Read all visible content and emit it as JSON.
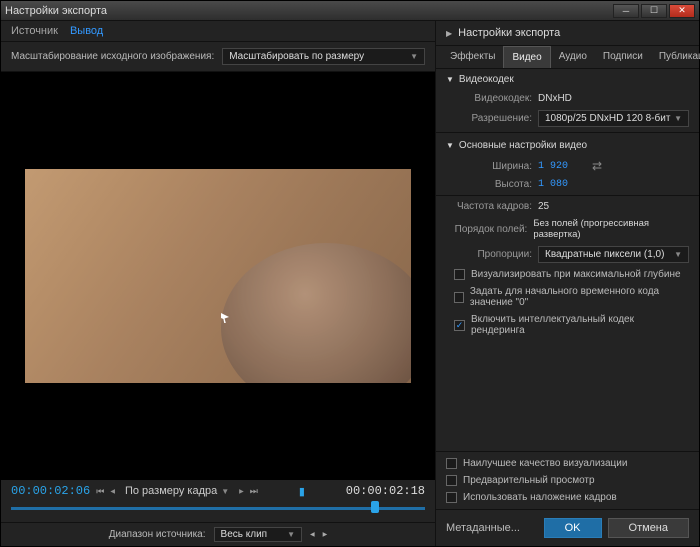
{
  "window": {
    "title": "Настройки экспорта"
  },
  "left": {
    "tabs": [
      "Источник",
      "Вывод"
    ],
    "scale": {
      "label": "Масштабирование исходного изображения:",
      "value": "Масштабировать по размеру"
    },
    "timebar": {
      "tc_in": "00:00:02:06",
      "tc_out": "00:00:02:18",
      "fit": "По размеру кадра"
    },
    "range": {
      "label": "Диапазон источника:",
      "value": "Весь клип"
    }
  },
  "right": {
    "header": "Настройки экспорта",
    "tabs": [
      "Эффекты",
      "Видео",
      "Аудио",
      "Подписи",
      "Публикация"
    ],
    "codec": {
      "title": "Видеокодек",
      "codec_label": "Видеокодек:",
      "codec_value": "DNxHD",
      "res_label": "Разрешение:",
      "res_value": "1080p/25 DNxHD 120 8-бит"
    },
    "basic": {
      "title": "Основные настройки видео",
      "width_label": "Ширина:",
      "width_value": "1 920",
      "height_label": "Высота:",
      "height_value": "1 080",
      "fps_label": "Частота кадров:",
      "fps_value": "25",
      "fields_label": "Порядок полей:",
      "fields_value": "Без полей (прогрессивная развертка)",
      "aspect_label": "Пропорции:",
      "aspect_value": "Квадратные пиксели (1,0)"
    },
    "checks": [
      "Визуализировать при максимальной глубине",
      "Задать для начального временного кода значение \"0\"",
      "Включить интеллектуальный кодек рендеринга"
    ],
    "bottom": [
      "Наилучшее качество визуализации",
      "Предварительный просмотр",
      "Использовать наложение кадров"
    ],
    "buttons": {
      "metadata": "Метаданные...",
      "ok": "OK",
      "cancel": "Отмена"
    }
  }
}
